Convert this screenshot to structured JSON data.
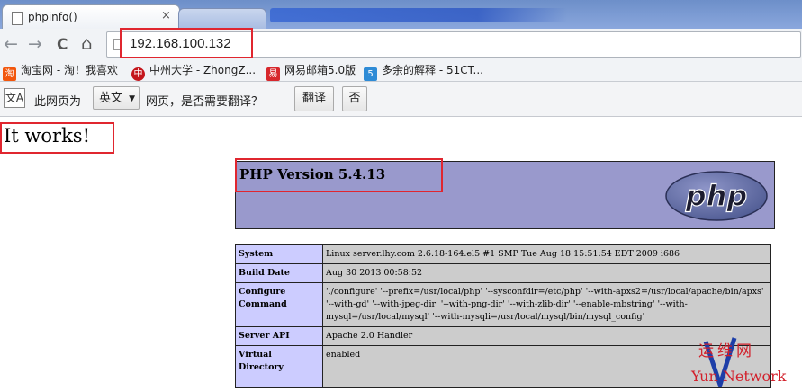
{
  "browser": {
    "active_tab_title": "phpinfo()",
    "tab_close_glyph": "×",
    "url": "192.168.100.132",
    "nav": {
      "back": "←",
      "forward": "→",
      "reload": "C",
      "home": "⌂"
    }
  },
  "bookmarks": [
    {
      "label": "淘宝网 - 淘！我喜欢",
      "icon": "taobao-icon",
      "color": "#f2560c",
      "glyph": "淘"
    },
    {
      "label": "中州大学 - ZhongZ...",
      "icon": "zhongzhou-university-icon",
      "color": "#c4161c",
      "glyph": "中"
    },
    {
      "label": "网易邮箱5.0版",
      "icon": "netease-mail-icon",
      "color": "#d7272c",
      "glyph": "易"
    },
    {
      "label": "多余的解释 - 51CT...",
      "icon": "51cto-icon",
      "color": "#2e8bd6",
      "glyph": "5"
    }
  ],
  "translate_bar": {
    "text_before": "此网页为",
    "language": "英文",
    "text_after": "网页，是否需要翻译？",
    "translate_button": "翻译",
    "no_button": "否",
    "icon_glyph": "文A"
  },
  "page": {
    "it_works": "It works!",
    "php_version": "PHP Version 5.4.13",
    "logo_text": "php",
    "rows": [
      {
        "key": "System",
        "value": "Linux server.lhy.com 2.6.18-164.el5 #1 SMP Tue Aug 18 15:51:54 EDT 2009 i686"
      },
      {
        "key": "Build Date",
        "value": "Aug 30 2013 00:58:52"
      },
      {
        "key": "Configure Command",
        "value": "'./configure' '--prefix=/usr/local/php' '--sysconfdir=/etc/php' '--with-apxs2=/usr/local/apache/bin/apxs' '--with-gd' '--with-jpeg-dir' '--with-png-dir' '--with-zlib-dir' '--enable-mbstring' '--with-mysql=/usr/local/mysql' '--with-mysqli=/usr/local/mysql/bin/mysql_config'"
      },
      {
        "key": "Server API",
        "value": "Apache 2.0 Handler"
      },
      {
        "key": "Virtual Directory",
        "value": "enabled"
      }
    ]
  },
  "watermark": {
    "cn": "运维网",
    "en": "Yun Network"
  },
  "colors": {
    "highlight": "#e0262f",
    "php_header": "#9999cc",
    "key_cell": "#ccccff",
    "value_cell": "#cccccc"
  }
}
